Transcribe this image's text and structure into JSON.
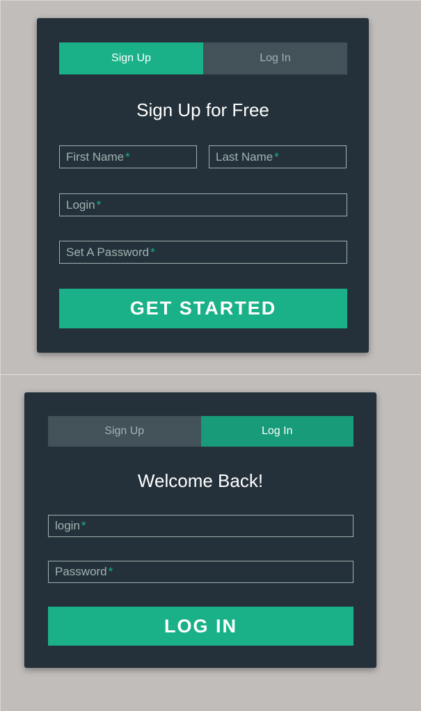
{
  "signup": {
    "tabs": {
      "signup": "Sign Up",
      "login": "Log In"
    },
    "heading": "Sign Up for Free",
    "fields": {
      "first_name": "First Name",
      "last_name": "Last Name",
      "login": "Login",
      "password": "Set A Password"
    },
    "required_mark": "*",
    "button": "GET STARTED"
  },
  "login": {
    "tabs": {
      "signup": "Sign Up",
      "login": "Log In"
    },
    "heading": "Welcome Back!",
    "fields": {
      "login": "login",
      "password": "Password"
    },
    "required_mark": "*",
    "button": "LOG IN"
  },
  "colors": {
    "background": "#c0bdbb",
    "card": "#24313a",
    "accent": "#1ab188",
    "inactive_tab": "#435159",
    "muted_text": "#a0b3b0"
  }
}
